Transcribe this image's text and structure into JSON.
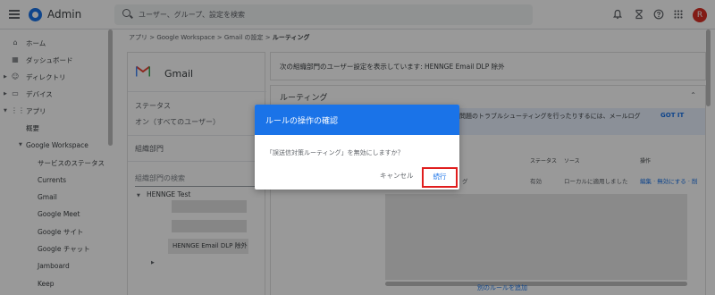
{
  "app": {
    "title": "Admin",
    "avatar_letter": "R"
  },
  "search": {
    "placeholder": "ユーザー、グループ、設定を検索"
  },
  "topbar_icons": [
    "bell-icon",
    "hourglass-icon",
    "help-icon",
    "apps-grid-icon"
  ],
  "sidebar": {
    "items": [
      {
        "label": "ホーム",
        "icon": "home-icon"
      },
      {
        "label": "ダッシュボード",
        "icon": "dashboard-icon"
      },
      {
        "label": "ディレクトリ",
        "icon": "person-icon"
      },
      {
        "label": "デバイス",
        "icon": "devices-icon"
      },
      {
        "label": "アプリ",
        "icon": "apps-icon"
      },
      {
        "label": "概要"
      },
      {
        "label": "Google Workspace"
      },
      {
        "label": "サービスのステータス"
      },
      {
        "label": "Currents"
      },
      {
        "label": "Gmail"
      },
      {
        "label": "Google Meet"
      },
      {
        "label": "Google サイト"
      },
      {
        "label": "Google チャット"
      },
      {
        "label": "Jamboard"
      },
      {
        "label": "Keep"
      }
    ]
  },
  "breadcrumb": {
    "items": [
      "アプリ",
      "Google Workspace",
      "Gmail の設定"
    ],
    "current": "ルーティング",
    "separator": ">"
  },
  "org_panel": {
    "service": "Gmail",
    "status_label": "ステータス",
    "status_value": "オン（すべてのユーザー）",
    "org_unit_label": "組織部門",
    "search_placeholder": "組織部門の検索",
    "root": "HENNGE Test",
    "selected_child": "HENNGE Email DLP 除外"
  },
  "info_bar": {
    "text": "次の組織部門のユーザー設定を表示しています: HENNGE Email DLP 除外"
  },
  "routing": {
    "title": "ルーティング",
    "banner_text": "る問題のトラブルシューティングを行ったりするには、メールログ",
    "banner_link": "GOT IT",
    "headers": [
      "ステータス",
      "ソース",
      "操作"
    ],
    "row": {
      "name_suffix": "グ",
      "status": "有効",
      "source": "ローカルに適用しました",
      "actions": "編集 · 無効にする · 削"
    },
    "add_rule": "別のルールを追加"
  },
  "dialog": {
    "title": "ルールの操作の確認",
    "message": "「誤送信対策ルーティング」を無効にしますか？",
    "cancel": "キャンセル",
    "continue": "続行"
  },
  "colors": {
    "accent": "#1a73e8",
    "avatar": "#d93025",
    "highlight_border": "#e01e1e",
    "overlay": "rgba(0,0,0,0.40)"
  }
}
